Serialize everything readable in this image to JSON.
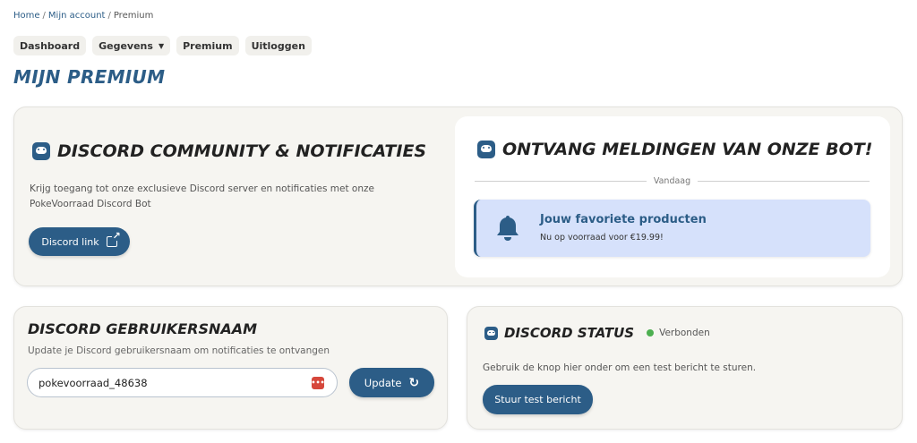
{
  "breadcrumb": {
    "home": "Home",
    "account": "Mijn account",
    "current": "Premium",
    "separator": "/"
  },
  "nav": {
    "dashboard": "Dashboard",
    "gegevens": "Gegevens",
    "premium": "Premium",
    "uitloggen": "Uitloggen"
  },
  "page_title": "MIJN PREMIUM",
  "community": {
    "title": "DISCORD COMMUNITY & NOTIFICATIES",
    "description": "Krijg toegang tot onze exclusieve Discord server en notificaties met onze PokeVoorraad Discord Bot",
    "button": "Discord link"
  },
  "bot": {
    "title": "ONTVANG MELDINGEN VAN ONZE BOT!",
    "divider": "Vandaag",
    "notification": {
      "title": "Jouw favoriete producten",
      "subtitle": "Nu op voorraad voor €19.99!"
    }
  },
  "username": {
    "title": "DISCORD GEBRUIKERSNAAM",
    "description": "Update je Discord gebruikersnaam om notificaties te ontvangen",
    "value": "pokevoorraad_48638",
    "button": "Update"
  },
  "status": {
    "title": "DISCORD STATUS",
    "state": "Verbonden",
    "description": "Gebruik de knop hier onder om een test bericht te sturen.",
    "button": "Stuur test bericht"
  },
  "colors": {
    "primary": "#2c5d87",
    "card_bg": "#f6f5f1",
    "notif_bg": "#d6e1fb",
    "connected": "#4caf50"
  }
}
